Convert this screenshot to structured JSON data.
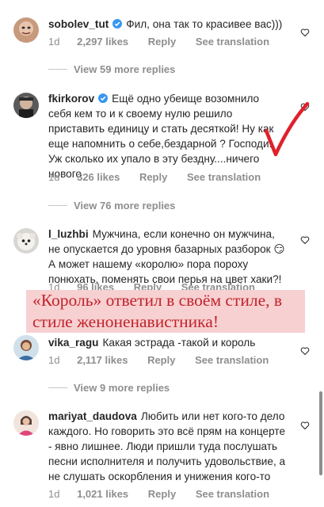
{
  "comments": [
    {
      "username": "sobolev_tut",
      "verified": true,
      "text": "Фил, она так то красивее вас)))",
      "age": "1d",
      "likes": "2,297 likes",
      "reply": "Reply",
      "see_translation": "See translation",
      "view_more": "View 59 more replies"
    },
    {
      "username": "fkirkorov",
      "verified": true,
      "text": "Ещё одно убеище возомнило себя кем то и к своему нулю решило приставить единицу и стать десяткой! Ну как еще напомнить о себе,бездарной ? Господи! Уж сколько их упало в эту бездну....ничего нового",
      "age": "1d",
      "likes": "326 likes",
      "reply": "Reply",
      "see_translation": "See translation",
      "view_more": "View 76 more replies"
    },
    {
      "username": "l_luzhbi",
      "verified": false,
      "text": "Мужчина, если конечно он мужчина, не опускается до уровня базарных разборок 😏 А может нашему «королю» пора пороху понюхать, поменять свои перья на цвет хаки?!",
      "age": "1d",
      "likes": "96 likes",
      "reply": "Reply",
      "see_translation": "See translation"
    },
    {
      "username": "vika_ragu",
      "verified": false,
      "text": "Какая эстрада -такой и король",
      "age": "1d",
      "likes": "2,117 likes",
      "reply": "Reply",
      "see_translation": "See translation",
      "view_more": "View 9 more replies"
    },
    {
      "username": "mariyat_daudova",
      "verified": false,
      "text": "Любить или нет кого-то дело каждого. Но говорить это всё прям на концерте - явно лишнее. Люди пришли туда послушать песни исполнителя и получить удовольствие, а не слушать оскорбления и унижения кого-то",
      "age": "1d",
      "likes": "1,021 likes",
      "reply": "Reply",
      "see_translation": "See translation"
    }
  ],
  "overlay_caption": "«Король» ответил в своём стиле, в стиле женоненавистника!",
  "colors": {
    "meta_gray": "#8e8e8e",
    "overlay_bg": "#f7d0d1",
    "overlay_text": "#c2232c",
    "verified_blue": "#3897f0",
    "checkmark_red": "#e0202a"
  },
  "icons": [
    "verified-badge-icon",
    "heart-icon",
    "red-checkmark-annotation"
  ]
}
